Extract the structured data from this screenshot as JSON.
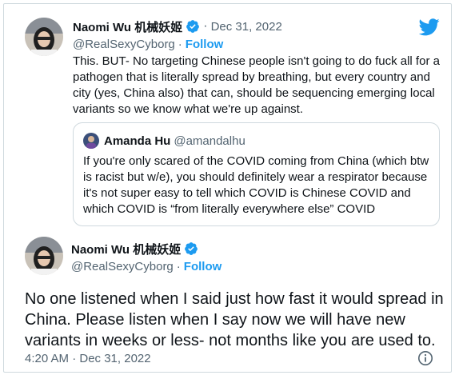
{
  "quoting_tweet": {
    "author_name": "Naomi Wu 机械妖姬",
    "date": "Dec 31, 2022",
    "handle": "@RealSexyCyborg",
    "follow_label": "Follow",
    "text": "This. BUT- No targeting Chinese people isn't going to do fuck all for a pathogen that is literally spread by breathing, but every country and city (yes, China also) that can, should be sequencing emerging local variants so we know what we're up against."
  },
  "quoted_tweet": {
    "author_name": "Amanda Hu",
    "handle": "@amandalhu",
    "text": "If you're only scared of the COVID coming from China (which btw is racist but w/e), you should definitely wear a respirator because it's not super easy to tell which COVID is Chinese COVID and which COVID is “from literally everywhere else” COVID"
  },
  "main_tweet": {
    "author_name": "Naomi Wu 机械妖姬",
    "handle": "@RealSexyCyborg",
    "follow_label": "Follow",
    "text": "No one listened when I said just how fast it would spread in China. Please listen when I say now we will have new variants in weeks or less- not months like you are used to.",
    "timestamp": "4:20 AM · Dec 31, 2022"
  },
  "separator": "·",
  "icons": {
    "brand": "twitter-bird-icon",
    "verified": "verified-badge-icon",
    "info": "info-icon"
  },
  "colors": {
    "accent": "#1d9bf0",
    "text": "#0f1419",
    "secondary": "#536471",
    "border": "#cfd9de"
  }
}
